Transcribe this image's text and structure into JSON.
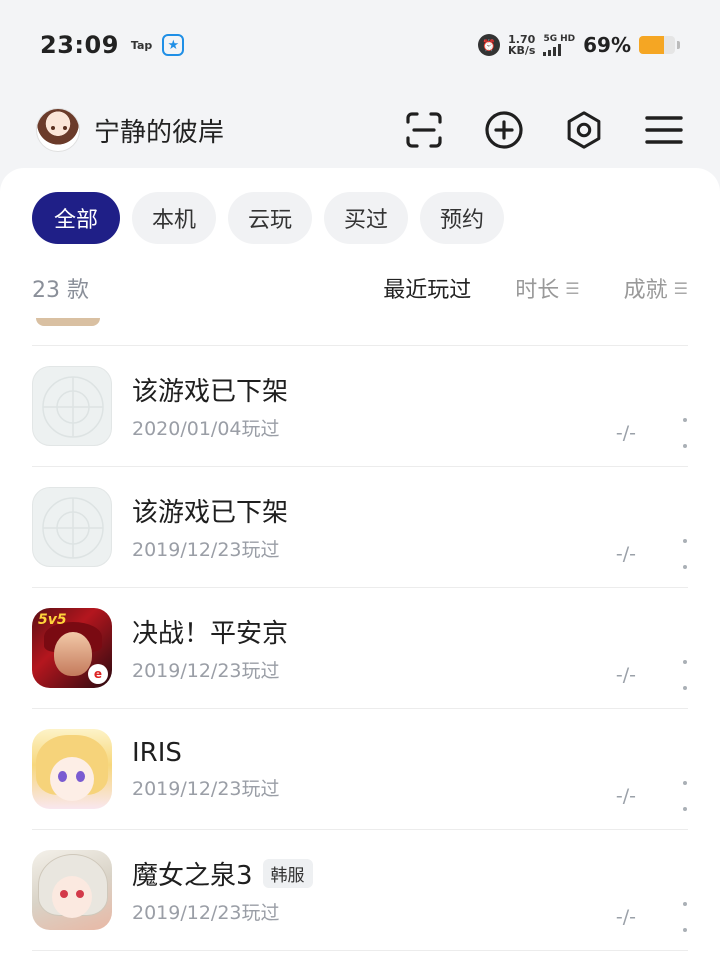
{
  "status": {
    "time": "23:09",
    "tap_label": "Tap",
    "net_speed_value": "1.70",
    "net_speed_unit": "KB/s",
    "network_label_1": "5G",
    "network_label_2": "HD",
    "battery_percent": "69%",
    "battery_level": 0.69,
    "battery_color": "#f5a623"
  },
  "header": {
    "username": "宁静的彼岸",
    "icons": [
      "scan-icon",
      "add-circle-icon",
      "settings-gear-icon",
      "menu-icon"
    ]
  },
  "filters": {
    "chips": [
      "全部",
      "本机",
      "云玩",
      "买过",
      "预约"
    ],
    "active_index": 0,
    "active_color": "#1f1f87"
  },
  "sort": {
    "count": "23 款",
    "recent": "最近玩过",
    "duration": "时长",
    "achievements": "成就"
  },
  "games": [
    {
      "title": "该游戏已下架",
      "played": "2020/01/04玩过",
      "duration": "-/-",
      "tag": ""
    },
    {
      "title": "该游戏已下架",
      "played": "2019/12/23玩过",
      "duration": "-/-",
      "tag": ""
    },
    {
      "title": "决战！平安京",
      "played": "2019/12/23玩过",
      "duration": "-/-",
      "tag": "",
      "icon_label": "5v5"
    },
    {
      "title": "IRIS",
      "played": "2019/12/23玩过",
      "duration": "-/-",
      "tag": ""
    },
    {
      "title": "魔女之泉3",
      "played": "2019/12/23玩过",
      "duration": "-/-",
      "tag": "韩服"
    }
  ]
}
